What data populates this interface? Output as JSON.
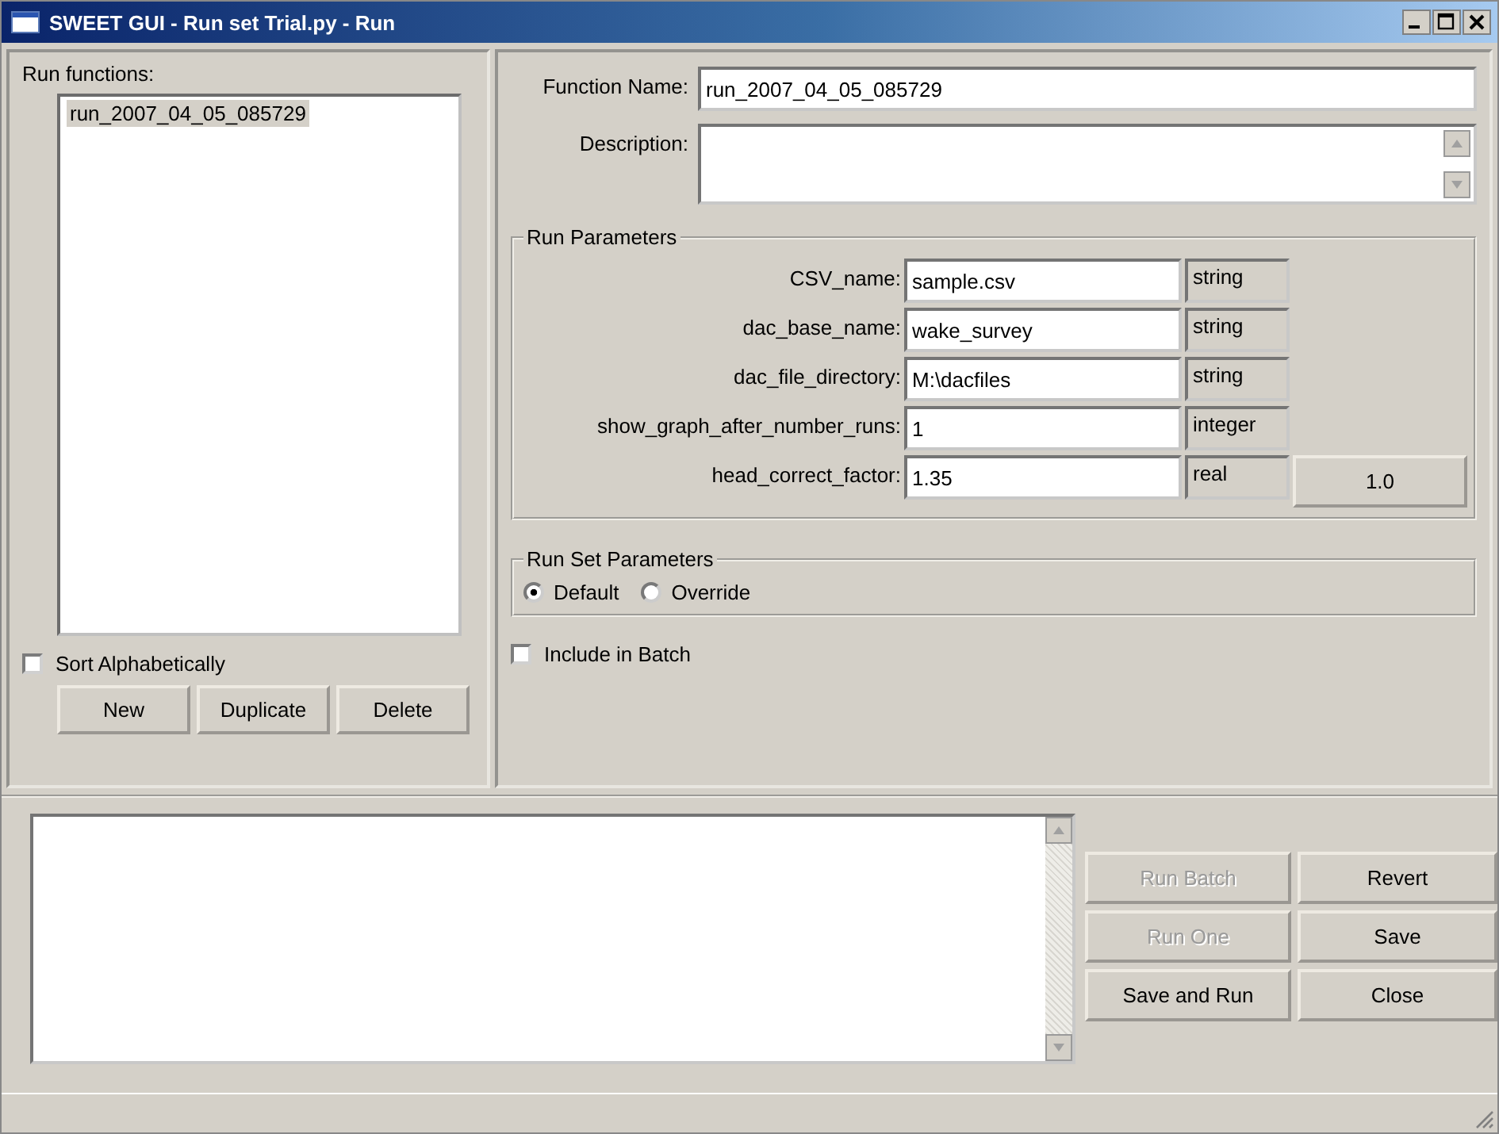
{
  "window": {
    "title": "SWEET GUI - Run set Trial.py - Run"
  },
  "run_functions": {
    "label": "Run functions:",
    "items": [
      {
        "label": "run_2007_04_05_085729",
        "selected": true
      }
    ],
    "sort_alphabetically": {
      "label": "Sort Alphabetically",
      "checked": false
    },
    "buttons": [
      {
        "label": "New"
      },
      {
        "label": "Duplicate"
      },
      {
        "label": "Delete"
      }
    ]
  },
  "function_name": {
    "label": "Function Name:",
    "value": "run_2007_04_05_085729"
  },
  "description": {
    "label": "Description:"
  },
  "run_parameters": {
    "title": "Run Parameters",
    "rows": [
      {
        "name": "CSV_name:",
        "value": "sample.csv",
        "type": "string"
      },
      {
        "name": "dac_base_name:",
        "value": "wake_survey",
        "type": "string"
      },
      {
        "name": "dac_file_directory:",
        "value": "M:\\dacfiles",
        "type": "string"
      },
      {
        "name": "show_graph_after_number_runs:",
        "value": "1",
        "type": "integer"
      },
      {
        "name": "head_correct_factor:",
        "value": "1.35",
        "type": "real",
        "default": "1.0"
      }
    ]
  },
  "run_set_parameters": {
    "title": "Run Set Parameters",
    "options": [
      {
        "label": "Default",
        "selected": true
      },
      {
        "label": "Override",
        "selected": false
      }
    ]
  },
  "include_in_batch": {
    "label": "Include in Batch",
    "checked": false
  },
  "actions": [
    {
      "label": "Run Batch",
      "disabled": true
    },
    {
      "label": "Revert",
      "disabled": false
    },
    {
      "label": "Run One",
      "disabled": true
    },
    {
      "label": "Save",
      "disabled": false
    },
    {
      "label": "Save and Run",
      "disabled": false
    },
    {
      "label": "Close",
      "disabled": false
    }
  ]
}
